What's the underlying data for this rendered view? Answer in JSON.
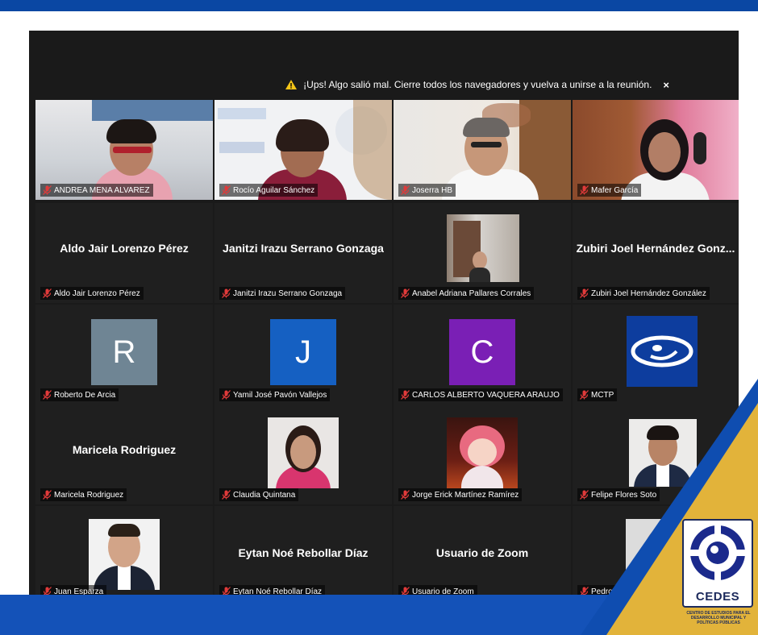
{
  "alert": {
    "text": "¡Ups! Algo salió mal. Cierre todos los navegadores y vuelva a unirse a la reunión.",
    "close": "×"
  },
  "participants": [
    {
      "name": "ANDREA MENA ALVAREZ",
      "display": "video"
    },
    {
      "name": "Rocío Aguilar Sánchez",
      "display": "video"
    },
    {
      "name": "Joserra HB",
      "display": "video"
    },
    {
      "name": "Mafer García",
      "display": "video"
    },
    {
      "name": "Aldo Jair Lorenzo Pérez",
      "display": "name",
      "big": "Aldo Jair Lorenzo Pérez"
    },
    {
      "name": "Janitzi Irazu Serrano Gonzaga",
      "display": "name",
      "big": "Janitzi Irazu Serrano Gonzaga"
    },
    {
      "name": "Anabel Adriana Pallares Corrales",
      "display": "photo"
    },
    {
      "name": "Zubiri Joel Hernández González",
      "display": "name",
      "big": "Zubiri Joel Hernández Gonz..."
    },
    {
      "name": "Roberto De Arcia",
      "display": "letter",
      "letter": "R",
      "color": "#6f8594"
    },
    {
      "name": "Yamil José Pavón Vallejos",
      "display": "letter",
      "letter": "J",
      "color": "#1560c2"
    },
    {
      "name": "CARLOS ALBERTO VAQUERA ARAUJO",
      "display": "letter",
      "letter": "C",
      "color": "#7a1fb5"
    },
    {
      "name": "MCTP",
      "display": "logo",
      "color": "#0d3d9e"
    },
    {
      "name": "Maricela Rodriguez",
      "display": "name",
      "big": "Maricela Rodriguez"
    },
    {
      "name": "Claudia Quintana",
      "display": "photo"
    },
    {
      "name": "Jorge Erick Martínez Ramírez",
      "display": "photo"
    },
    {
      "name": "Felipe Flores Soto",
      "display": "photo"
    },
    {
      "name": "Juan Esparza",
      "display": "photo"
    },
    {
      "name": "Eytan Noé Rebollar Díaz",
      "display": "name",
      "big": "Eytan Noé Rebollar Díaz"
    },
    {
      "name": "Usuario de Zoom",
      "display": "name",
      "big": "Usuario de Zoom"
    },
    {
      "name": "Pedro José",
      "display": "photo"
    }
  ],
  "overlay_logo": {
    "title": "CEDES",
    "subtitle": "CENTRO DE ESTUDIOS PARA EL DESARROLLO MUNICIPAL Y POLÍTICAS PÚBLICAS"
  },
  "colors": {
    "frame_blue": "#0d4fae",
    "gold": "#e2b33a",
    "zoom_bg": "#1a1a1a"
  }
}
